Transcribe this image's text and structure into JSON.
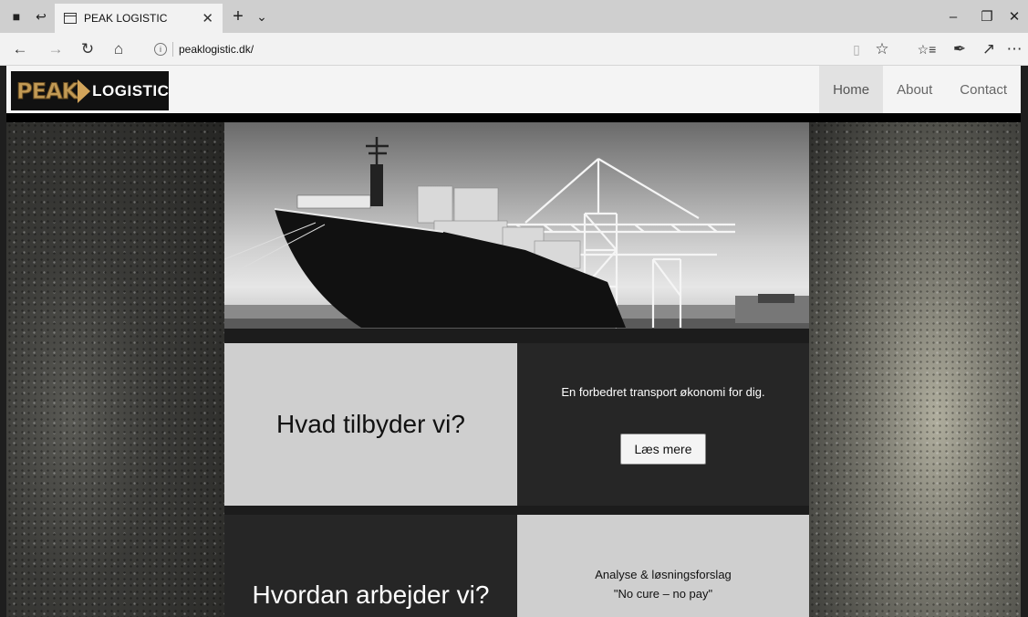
{
  "browser": {
    "tab_title": "PEAK LOGISTIC",
    "url": "peaklogistic.dk/"
  },
  "site": {
    "logo": {
      "peak": "PEAK",
      "word": "LOGISTIC"
    },
    "nav": [
      {
        "label": "Home",
        "active": true
      },
      {
        "label": "About",
        "active": false
      },
      {
        "label": "Contact",
        "active": false
      }
    ],
    "section1": {
      "heading": "Hvad tilbyder vi?",
      "text": "En forbedret transport økonomi for dig.",
      "button": "Læs mere"
    },
    "section2": {
      "heading": "Hvordan arbejder vi?",
      "line1": "Analyse & løsningsforslag",
      "line2": "\"No cure – no pay\""
    }
  },
  "colors": {
    "accent_gold": "#c29a55",
    "dark_panel": "#262626",
    "light_panel": "#cfcfcf"
  }
}
